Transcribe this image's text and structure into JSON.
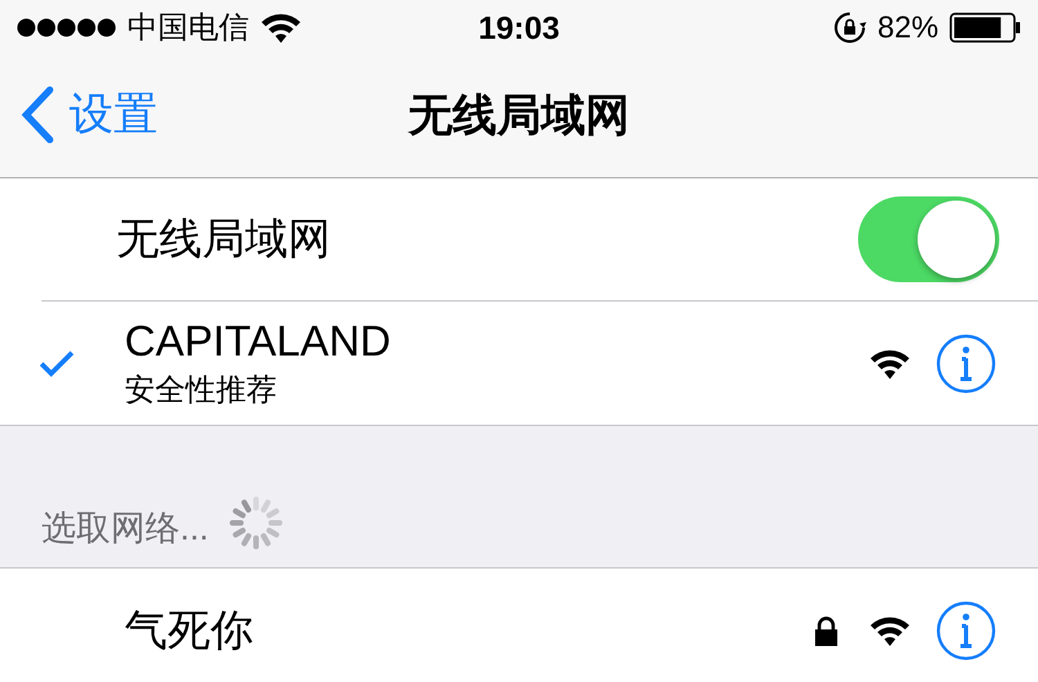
{
  "status_bar": {
    "carrier": "中国电信",
    "time": "19:03",
    "battery": "82%"
  },
  "nav_bar": {
    "back": "设置",
    "title": "无线局域网"
  },
  "wifi_switch": {
    "label": "无线局域网",
    "on": true
  },
  "current_networks": [
    {
      "name": "CAPITALAND",
      "subtitle": "安全性推荐",
      "selected": true,
      "secured": false
    }
  ],
  "section_header": {
    "title": "选取网络...",
    "loading": true
  },
  "other_networks": [
    {
      "name": "气死你",
      "selected": false,
      "secured": true
    }
  ]
}
